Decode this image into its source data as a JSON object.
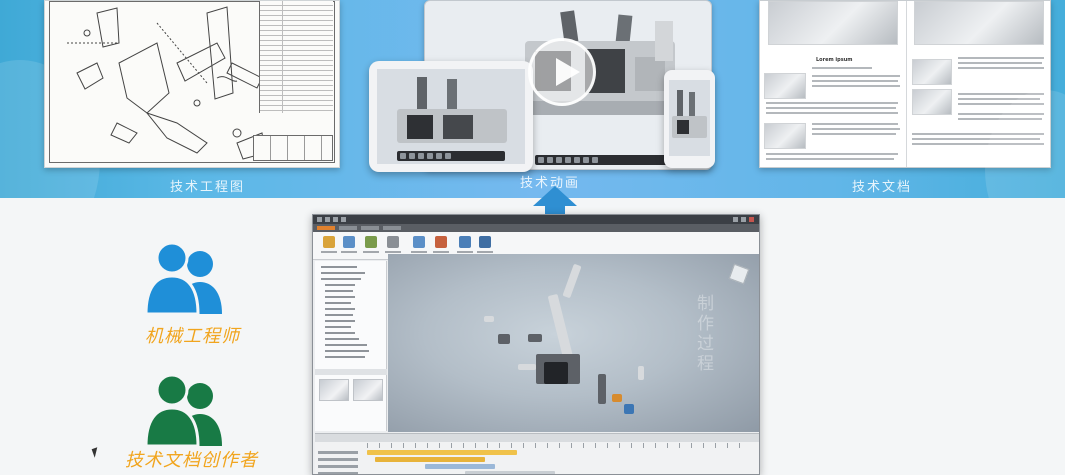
{
  "banner": {
    "captions": {
      "drawings": "技术工程图",
      "animation": "技术动画",
      "documents": "技术文档"
    },
    "accent_color": "#75b9ef"
  },
  "documents": {
    "page_heading": "Lorem ipsum"
  },
  "app_window": {
    "watermark": "制作过程"
  },
  "personas": [
    {
      "label": "机械工程师",
      "icon": "users-icon",
      "color": "#1f8fd8"
    },
    {
      "label": "技术文档创作者",
      "icon": "users-icon",
      "color": "#187a45"
    }
  ],
  "role_color": "#f1a51e",
  "arrow_icon": "arrow-up-icon"
}
